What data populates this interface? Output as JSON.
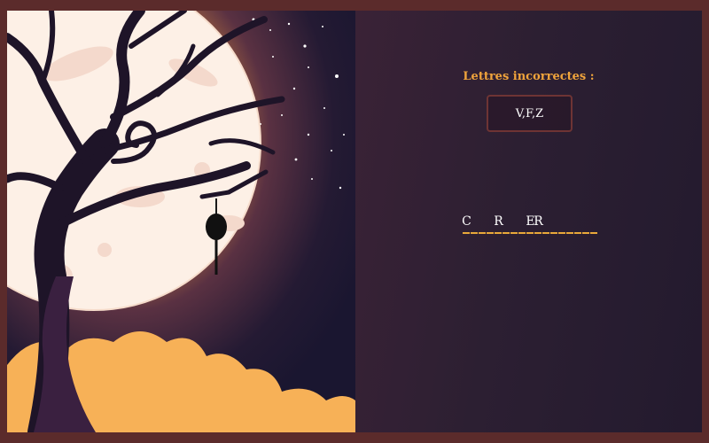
{
  "game": {
    "wrong_letters_label": "Lettres incorrectes :",
    "wrong_letters_value": "V,F,Z",
    "word_slots": [
      "C",
      "",
      "",
      "",
      "R",
      "",
      "",
      "",
      "E",
      "R",
      "",
      "",
      "",
      "",
      "",
      "",
      ""
    ]
  },
  "colors": {
    "frame": "#5b2b2b",
    "accent": "#f0a43c",
    "panel_dark": "#231a2e",
    "moon": "#fdf0e6",
    "tree": "#1e1428",
    "cloud": "#f7b157"
  },
  "scene": {
    "elements": [
      "moon",
      "dead-tree",
      "hanged-figure",
      "clouds",
      "stars"
    ]
  }
}
